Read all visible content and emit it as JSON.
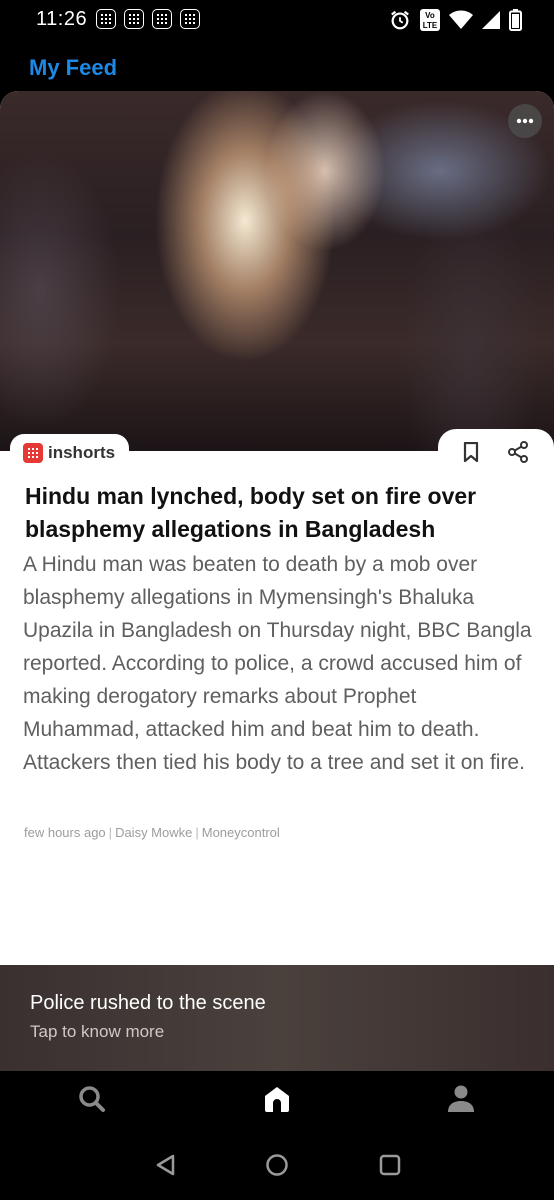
{
  "status_bar": {
    "time": "11:26",
    "lte_top": "Vo",
    "lte_bottom": "LTE",
    "notification_icons": [
      "app-notification-icon",
      "app-notification-icon",
      "app-notification-icon",
      "app-notification-icon"
    ]
  },
  "header": {
    "title": "My Feed"
  },
  "card": {
    "brand": "inshorts",
    "headline": "Hindu man lynched, body set on fire over blasphemy allegations in Bangladesh",
    "body": "A Hindu man was beaten to death by a mob over blasphemy allegations in Mymensingh's Bhaluka Upazila in Bangladesh on Thursday night, BBC Bangla reported. According to police, a crowd accused him of making derogatory remarks about Prophet Muhammad, attacked him and beat him to death. Attackers then tied his body to a tree and set it on fire.",
    "meta": {
      "time": "few hours ago",
      "author": "Daisy Mowke",
      "source": "Moneycontrol"
    },
    "footer": {
      "title": "Police rushed to the scene",
      "subtitle": "Tap to know more"
    }
  },
  "bottom_nav": {
    "items": [
      "search-icon",
      "home-icon",
      "profile-icon"
    ],
    "active": "home-icon"
  },
  "colors": {
    "accent": "#1e88e5",
    "brand_red": "#e53935"
  }
}
